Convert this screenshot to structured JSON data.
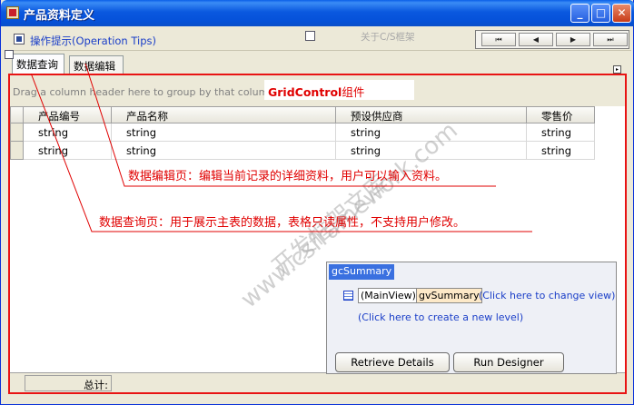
{
  "window": {
    "title": "产品资料定义",
    "min_glyph": "_",
    "max_glyph": "□",
    "close_glyph": "✕"
  },
  "toolbar": {
    "tips_link": "操作提示(Operation Tips)",
    "about_link": "关于C/S框架",
    "nav": {
      "first": "⏮",
      "prev": "◀",
      "next": "▶",
      "last": "⏭"
    }
  },
  "tabs": [
    {
      "label": "数据查询",
      "active": true
    },
    {
      "label": "数据编辑",
      "active": false
    }
  ],
  "grid": {
    "group_hint": "Drag a column header here to group by that column",
    "label_prefix": "GridControl",
    "label_suffix": "组件",
    "columns": [
      "产品编号",
      "产品名称",
      "预设供应商",
      "零售价"
    ],
    "rows": [
      [
        "string",
        "string",
        "string",
        "string"
      ],
      [
        "string",
        "string",
        "string",
        "string"
      ]
    ]
  },
  "annotations": {
    "edit_page": "数据编辑页：编辑当前记录的详细资料，用户可以输入资料。",
    "query_page": "数据查询页：用于展示主表的数据，表格只读属性，不支持用户修改。"
  },
  "watermark": {
    "line1": "www.csframework.com",
    "line2": "开发框架文库"
  },
  "designer": {
    "title": "gcSummary",
    "main_view": "(MainView)",
    "view_name": "gvSummary",
    "change_view": "(Click here to change view)",
    "new_level": "(Click here to create a new level)",
    "retrieve_details": "Retrieve Details",
    "run_designer": "Run Designer"
  },
  "footer": {
    "total_label": "总计:"
  },
  "colors": {
    "annotation": "#e00000",
    "title_bar": "#0a58df",
    "link": "#1a3ec8"
  }
}
